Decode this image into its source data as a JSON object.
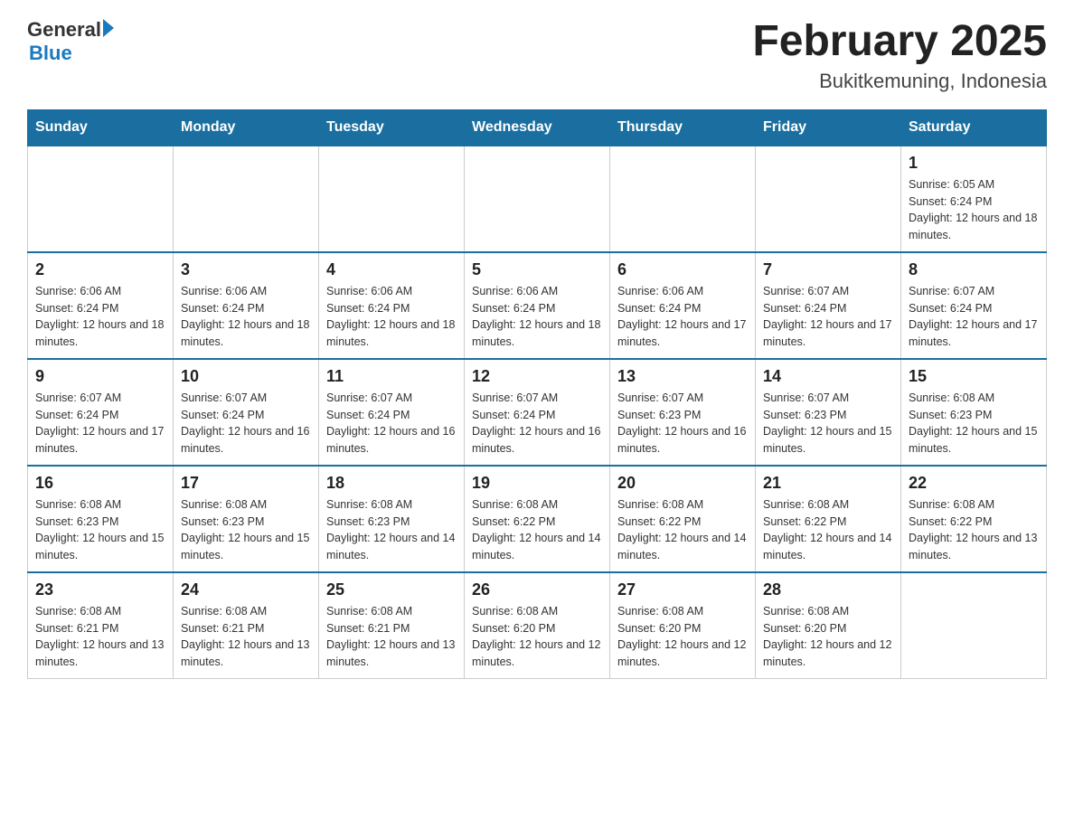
{
  "logo": {
    "text_general": "General",
    "text_blue": "Blue",
    "arrow_color": "#1a7abf"
  },
  "header": {
    "title": "February 2025",
    "subtitle": "Bukitkemuning, Indonesia"
  },
  "days_of_week": [
    "Sunday",
    "Monday",
    "Tuesday",
    "Wednesday",
    "Thursday",
    "Friday",
    "Saturday"
  ],
  "weeks": [
    {
      "days": [
        {
          "date": "",
          "sunrise": "",
          "sunset": "",
          "daylight": ""
        },
        {
          "date": "",
          "sunrise": "",
          "sunset": "",
          "daylight": ""
        },
        {
          "date": "",
          "sunrise": "",
          "sunset": "",
          "daylight": ""
        },
        {
          "date": "",
          "sunrise": "",
          "sunset": "",
          "daylight": ""
        },
        {
          "date": "",
          "sunrise": "",
          "sunset": "",
          "daylight": ""
        },
        {
          "date": "",
          "sunrise": "",
          "sunset": "",
          "daylight": ""
        },
        {
          "date": "1",
          "sunrise": "Sunrise: 6:05 AM",
          "sunset": "Sunset: 6:24 PM",
          "daylight": "Daylight: 12 hours and 18 minutes."
        }
      ]
    },
    {
      "days": [
        {
          "date": "2",
          "sunrise": "Sunrise: 6:06 AM",
          "sunset": "Sunset: 6:24 PM",
          "daylight": "Daylight: 12 hours and 18 minutes."
        },
        {
          "date": "3",
          "sunrise": "Sunrise: 6:06 AM",
          "sunset": "Sunset: 6:24 PM",
          "daylight": "Daylight: 12 hours and 18 minutes."
        },
        {
          "date": "4",
          "sunrise": "Sunrise: 6:06 AM",
          "sunset": "Sunset: 6:24 PM",
          "daylight": "Daylight: 12 hours and 18 minutes."
        },
        {
          "date": "5",
          "sunrise": "Sunrise: 6:06 AM",
          "sunset": "Sunset: 6:24 PM",
          "daylight": "Daylight: 12 hours and 18 minutes."
        },
        {
          "date": "6",
          "sunrise": "Sunrise: 6:06 AM",
          "sunset": "Sunset: 6:24 PM",
          "daylight": "Daylight: 12 hours and 17 minutes."
        },
        {
          "date": "7",
          "sunrise": "Sunrise: 6:07 AM",
          "sunset": "Sunset: 6:24 PM",
          "daylight": "Daylight: 12 hours and 17 minutes."
        },
        {
          "date": "8",
          "sunrise": "Sunrise: 6:07 AM",
          "sunset": "Sunset: 6:24 PM",
          "daylight": "Daylight: 12 hours and 17 minutes."
        }
      ]
    },
    {
      "days": [
        {
          "date": "9",
          "sunrise": "Sunrise: 6:07 AM",
          "sunset": "Sunset: 6:24 PM",
          "daylight": "Daylight: 12 hours and 17 minutes."
        },
        {
          "date": "10",
          "sunrise": "Sunrise: 6:07 AM",
          "sunset": "Sunset: 6:24 PM",
          "daylight": "Daylight: 12 hours and 16 minutes."
        },
        {
          "date": "11",
          "sunrise": "Sunrise: 6:07 AM",
          "sunset": "Sunset: 6:24 PM",
          "daylight": "Daylight: 12 hours and 16 minutes."
        },
        {
          "date": "12",
          "sunrise": "Sunrise: 6:07 AM",
          "sunset": "Sunset: 6:24 PM",
          "daylight": "Daylight: 12 hours and 16 minutes."
        },
        {
          "date": "13",
          "sunrise": "Sunrise: 6:07 AM",
          "sunset": "Sunset: 6:23 PM",
          "daylight": "Daylight: 12 hours and 16 minutes."
        },
        {
          "date": "14",
          "sunrise": "Sunrise: 6:07 AM",
          "sunset": "Sunset: 6:23 PM",
          "daylight": "Daylight: 12 hours and 15 minutes."
        },
        {
          "date": "15",
          "sunrise": "Sunrise: 6:08 AM",
          "sunset": "Sunset: 6:23 PM",
          "daylight": "Daylight: 12 hours and 15 minutes."
        }
      ]
    },
    {
      "days": [
        {
          "date": "16",
          "sunrise": "Sunrise: 6:08 AM",
          "sunset": "Sunset: 6:23 PM",
          "daylight": "Daylight: 12 hours and 15 minutes."
        },
        {
          "date": "17",
          "sunrise": "Sunrise: 6:08 AM",
          "sunset": "Sunset: 6:23 PM",
          "daylight": "Daylight: 12 hours and 15 minutes."
        },
        {
          "date": "18",
          "sunrise": "Sunrise: 6:08 AM",
          "sunset": "Sunset: 6:23 PM",
          "daylight": "Daylight: 12 hours and 14 minutes."
        },
        {
          "date": "19",
          "sunrise": "Sunrise: 6:08 AM",
          "sunset": "Sunset: 6:22 PM",
          "daylight": "Daylight: 12 hours and 14 minutes."
        },
        {
          "date": "20",
          "sunrise": "Sunrise: 6:08 AM",
          "sunset": "Sunset: 6:22 PM",
          "daylight": "Daylight: 12 hours and 14 minutes."
        },
        {
          "date": "21",
          "sunrise": "Sunrise: 6:08 AM",
          "sunset": "Sunset: 6:22 PM",
          "daylight": "Daylight: 12 hours and 14 minutes."
        },
        {
          "date": "22",
          "sunrise": "Sunrise: 6:08 AM",
          "sunset": "Sunset: 6:22 PM",
          "daylight": "Daylight: 12 hours and 13 minutes."
        }
      ]
    },
    {
      "days": [
        {
          "date": "23",
          "sunrise": "Sunrise: 6:08 AM",
          "sunset": "Sunset: 6:21 PM",
          "daylight": "Daylight: 12 hours and 13 minutes."
        },
        {
          "date": "24",
          "sunrise": "Sunrise: 6:08 AM",
          "sunset": "Sunset: 6:21 PM",
          "daylight": "Daylight: 12 hours and 13 minutes."
        },
        {
          "date": "25",
          "sunrise": "Sunrise: 6:08 AM",
          "sunset": "Sunset: 6:21 PM",
          "daylight": "Daylight: 12 hours and 13 minutes."
        },
        {
          "date": "26",
          "sunrise": "Sunrise: 6:08 AM",
          "sunset": "Sunset: 6:20 PM",
          "daylight": "Daylight: 12 hours and 12 minutes."
        },
        {
          "date": "27",
          "sunrise": "Sunrise: 6:08 AM",
          "sunset": "Sunset: 6:20 PM",
          "daylight": "Daylight: 12 hours and 12 minutes."
        },
        {
          "date": "28",
          "sunrise": "Sunrise: 6:08 AM",
          "sunset": "Sunset: 6:20 PM",
          "daylight": "Daylight: 12 hours and 12 minutes."
        },
        {
          "date": "",
          "sunrise": "",
          "sunset": "",
          "daylight": ""
        }
      ]
    }
  ]
}
